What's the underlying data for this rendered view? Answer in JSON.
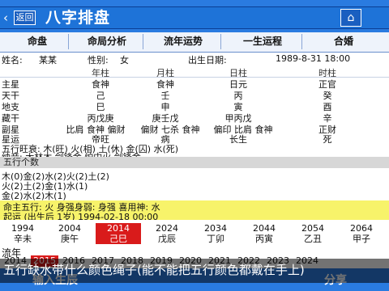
{
  "header": {
    "title": "八字排盘",
    "back_label": "返回",
    "back_arrow": "‹",
    "home_label": "⌂"
  },
  "tabs": [
    "命盘",
    "命局分析",
    "流年运势",
    "一生运程",
    "合婚"
  ],
  "info": {
    "name_label": "姓名:",
    "name_value": "某某",
    "sex_label": "性别:",
    "sex_value": "女",
    "date_label": "出生日期:",
    "date_value": "1989-8-31 18:00"
  },
  "grid": {
    "headers": [
      "年柱",
      "月柱",
      "日柱",
      "时柱"
    ],
    "rows": [
      {
        "label": "主星",
        "cells": [
          "食神",
          "食神",
          "日元",
          "正官"
        ]
      },
      {
        "label": "天干",
        "cells": [
          "己",
          "壬",
          "丙",
          "癸"
        ]
      },
      {
        "label": "地支",
        "cells": [
          "巳",
          "申",
          "寅",
          "酉"
        ]
      },
      {
        "label": "藏干",
        "cells": [
          "丙戊庚",
          "庚壬戊",
          "甲丙戊",
          "辛"
        ]
      },
      {
        "label": "副星",
        "cells": [
          "比肩 食神 偏财",
          "偏财 七杀 食神",
          "偏印 比肩 食神",
          "正财"
        ]
      },
      {
        "label": "星运",
        "cells": [
          "帝旺",
          "病",
          "长生",
          "死"
        ]
      }
    ]
  },
  "mid": {
    "line1": "五行旺衰: 木(旺) 火(相) 土(休) 金(囚) 水(死)",
    "line2": "纳音: 大林木  剑锋金  炉中火  剑锋金"
  },
  "band": {
    "text": "五行个数"
  },
  "wuxing_lines": [
    "木(0)金(2)水(2)火(2)土(2)",
    "火(2)土(2)金(1)水(1)",
    "金(2)水(2)木(1)"
  ],
  "yellow": {
    "line1": "命主五行: 火  身强身弱: 身强  喜用神: 水",
    "line2": "起运 (出生后 1岁)  1994-02-18 00:00"
  },
  "dayun": [
    {
      "age": "1994",
      "gz": "辛未"
    },
    {
      "age": "2004",
      "gz": "庚午"
    },
    {
      "age": "2014",
      "gz": "己巳"
    },
    {
      "age": "2024",
      "gz": "戊辰"
    },
    {
      "age": "2034",
      "gz": "丁卯"
    },
    {
      "age": "2044",
      "gz": "丙寅"
    },
    {
      "age": "2054",
      "gz": "乙丑"
    },
    {
      "age": "2064",
      "gz": "甲子"
    }
  ],
  "liunian_label": "流年",
  "years": [
    "2014",
    "2015",
    "2016",
    "2017",
    "2018",
    "2019",
    "2020",
    "2021",
    "2022",
    "2023",
    "2024"
  ],
  "active_year_index": 1,
  "active_dayun_index": 2,
  "bottom": {
    "left": "输入生辰",
    "right": "分享"
  },
  "caption": "五行缺水带什么颜色绳子(能不能把五行颜色都戴在手上)"
}
